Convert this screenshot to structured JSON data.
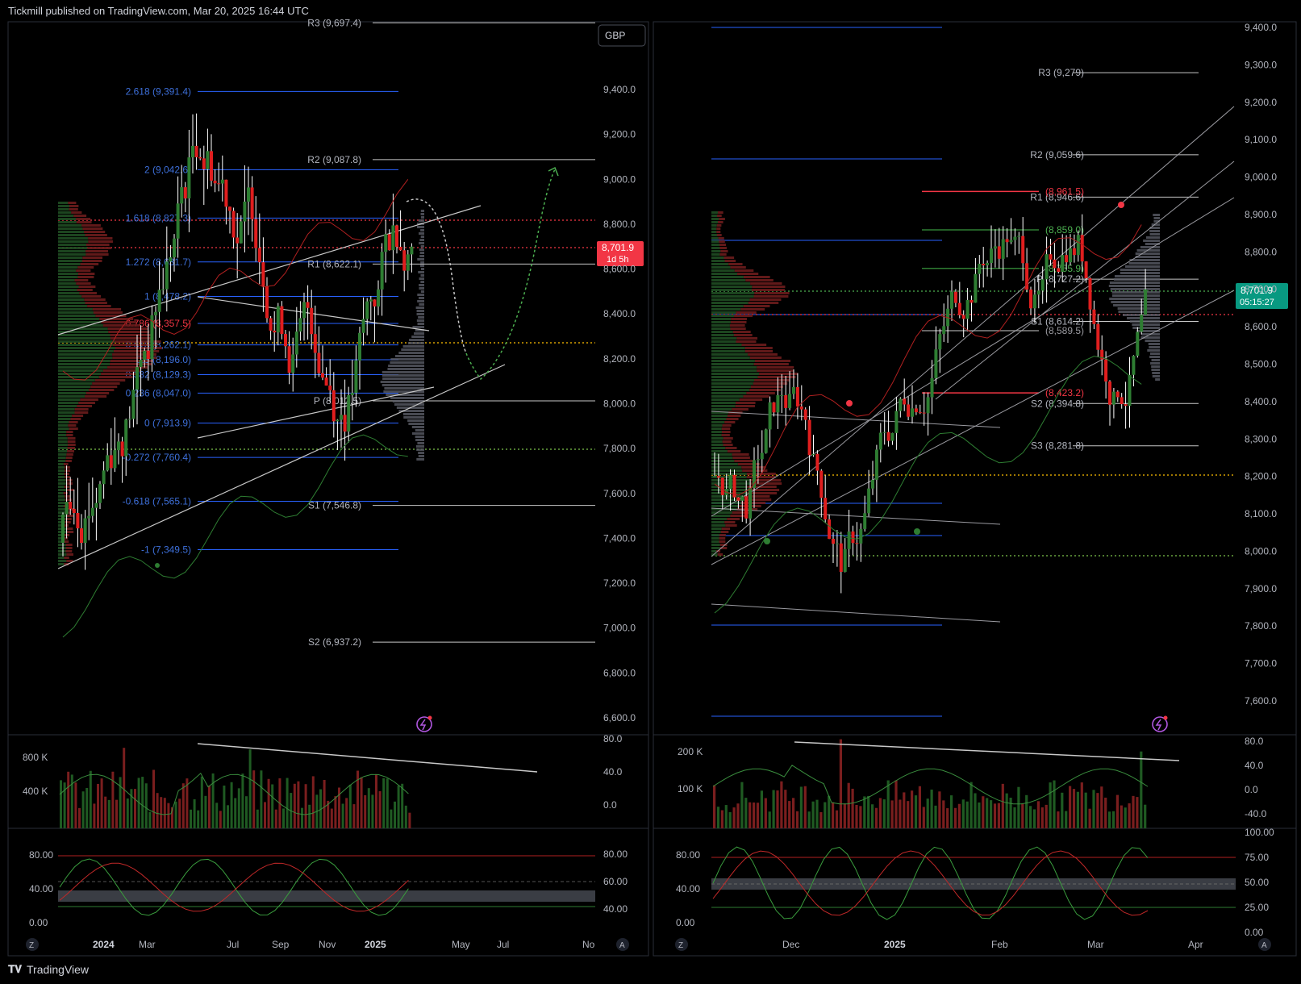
{
  "header": {
    "published": "Tickmill published on TradingView.com, Mar 20, 2025 16:44 UTC"
  },
  "footer": {
    "brand": "TradingView"
  },
  "colors": {
    "bg": "#000000",
    "up": "#2e7d32",
    "down": "#e01e1e",
    "pivot": "#c8c8c8",
    "fib": "#2962ff",
    "price_tag": "#f23645",
    "price_tag_right": "#089981",
    "projection": "#4caf50",
    "dots": "#ffc000"
  },
  "chart_data": [
    {
      "type": "candlestick",
      "panel": "left",
      "currency_badge": "GBP",
      "price_tag": {
        "value": "8,701.9",
        "sub": "1d 5h"
      },
      "y_ticks": [
        "9,400.0",
        "9,200.0",
        "9,000.0",
        "8,800.0",
        "8,600.0",
        "8,400.0",
        "8,200.0",
        "8,000.0",
        "7,800.0",
        "7,600.0",
        "7,400.0",
        "7,200.0",
        "7,000.0",
        "6,800.0",
        "6,600.0"
      ],
      "y_tick_values": [
        9400,
        9200,
        9000,
        8800,
        8600,
        8400,
        8200,
        8000,
        7800,
        7600,
        7400,
        7200,
        7000,
        6800,
        6600
      ],
      "x_ticks": [
        "2024",
        "Mar",
        "Jul",
        "Sep",
        "Nov",
        "2025",
        "May",
        "Jul",
        "No"
      ],
      "pivot_levels": [
        {
          "label": "R3 (9,697.4)",
          "value": 9697.4
        },
        {
          "label": "R2 (9,087.8)",
          "value": 9087.8
        },
        {
          "label": "R1 (8,622.1)",
          "value": 8622.1
        },
        {
          "label": "P (8,012.5)",
          "value": 8012.5
        },
        {
          "label": "S1 (7,546.8)",
          "value": 7546.8
        },
        {
          "label": "S2 (6,937.2)",
          "value": 6937.2
        }
      ],
      "fib_levels": [
        {
          "label": "2.618 (9,391.4)",
          "value": 9391.4
        },
        {
          "label": "2 (9,042.6)",
          "value": 9042.6
        },
        {
          "label": "1.618 (8,827.3)",
          "value": 8827.3
        },
        {
          "label": "1.272 (8,631.7)",
          "value": 8631.7
        },
        {
          "label": "1 (8,478.2)",
          "value": 8478.2
        },
        {
          "label": "0.786 (8,357.5)",
          "value": 8357.5
        },
        {
          "label": "0.618 (8,262.1)",
          "value": 8262.1
        },
        {
          "label": "0.5 (8,196.0)",
          "value": 8196.0
        },
        {
          "label": "0.382 (8,129.3)",
          "value": 8129.3
        },
        {
          "label": "0.236 (8,047.0)",
          "value": 8047.0
        },
        {
          "label": "0 (7,913.9)",
          "value": 7913.9
        },
        {
          "label": "-0.272 (7,760.4)",
          "value": 7760.4
        },
        {
          "label": "-0.618 (7,565.1)",
          "value": 7565.1
        },
        {
          "label": "-1 (7,349.5)",
          "value": 7349.5
        }
      ],
      "volume_panel": {
        "y_ticks": [
          "800 K",
          "400 K"
        ],
        "osc_ticks": [
          "80.0",
          "40.0",
          "0.0"
        ]
      },
      "stoch_panel": {
        "left_ticks": [
          "80.00",
          "40.00",
          "0.00"
        ],
        "right_ticks": [
          "80.00",
          "60.00",
          "40.00"
        ]
      }
    },
    {
      "type": "candlestick",
      "panel": "right",
      "price_tag": {
        "value": "8,701.9",
        "sub": "05:15:27"
      },
      "y_ticks": [
        "9,400.0",
        "9,300.0",
        "9,200.0",
        "9,100.0",
        "9,000.0",
        "8,900.0",
        "8,800.0",
        "8,700.0",
        "8,600.0",
        "8,500.0",
        "8,400.0",
        "8,300.0",
        "8,200.0",
        "8,100.0",
        "8,000.0",
        "7,900.0",
        "7,800.0",
        "7,700.0",
        "7,600.0"
      ],
      "y_tick_values": [
        9400,
        9300,
        9200,
        9100,
        9000,
        8900,
        8800,
        8700,
        8600,
        8500,
        8400,
        8300,
        8200,
        8100,
        8000,
        7900,
        7800,
        7700,
        7600
      ],
      "x_ticks": [
        "Dec",
        "2025",
        "Feb",
        "Mar",
        "Apr"
      ],
      "pivot_levels": [
        {
          "label": "R3 (9,279)",
          "value": 9279
        },
        {
          "label": "R2 (9,059.6)",
          "value": 9059.6
        },
        {
          "label": "R1 (8,946.6)",
          "value": 8946.6
        },
        {
          "label": "P (8,727.2)",
          "value": 8727.2
        },
        {
          "label": "S1 (8,614.2)",
          "value": 8614.2
        },
        {
          "label": "S2 (8,394.8)",
          "value": 8394.8
        },
        {
          "label": "S3 (8,281.8)",
          "value": 8281.8
        }
      ],
      "swing_levels": [
        {
          "label": "(8,961.5)",
          "value": 8961.5
        },
        {
          "label": "(8,859.0)",
          "value": 8859.0
        },
        {
          "label": "(8,755.9)",
          "value": 8755.9
        },
        {
          "label": "(8,589.5)",
          "value": 8589.5
        },
        {
          "label": "(8,423.2)",
          "value": 8423.2
        }
      ],
      "volume_panel": {
        "y_ticks": [
          "200 K",
          "100 K"
        ],
        "osc_ticks": [
          "80.0",
          "40.0",
          "0.0",
          "-40.0"
        ]
      },
      "stoch_panel": {
        "left_ticks": [
          "80.00",
          "40.00",
          "0.00"
        ],
        "right_ticks": [
          "100.00",
          "75.00",
          "50.00",
          "25.00",
          "0.00"
        ]
      }
    }
  ]
}
